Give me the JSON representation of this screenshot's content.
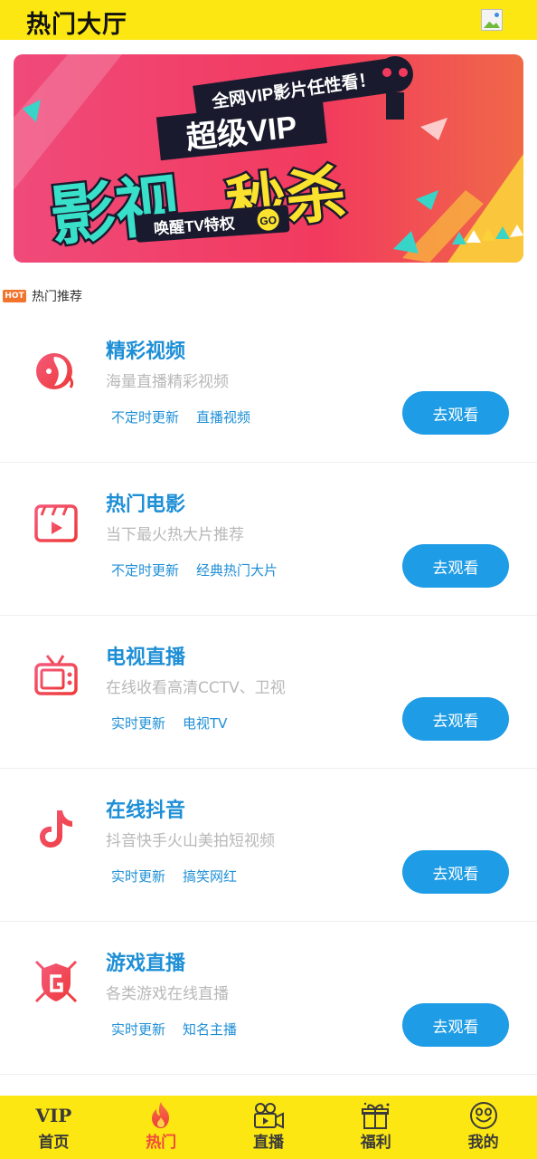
{
  "header": {
    "title": "热门大厅"
  },
  "banner": {
    "top_text": "全网VIP影片任性看！",
    "super_vip": "超级VIP",
    "main_text_1": "影视",
    "main_text_2": "秒杀",
    "sub_text": "唤醒TV特权",
    "go": "GO"
  },
  "section": {
    "badge": "HOT",
    "label": "热门推荐"
  },
  "cards": [
    {
      "title": "精彩视频",
      "desc": "海量直播精彩视频",
      "tags": [
        "不定时更新",
        "直播视频"
      ],
      "button": "去观看",
      "icon": "woman-face-icon"
    },
    {
      "title": "热门电影",
      "desc": "当下最火热大片推荐",
      "tags": [
        "不定时更新",
        "经典热门大片"
      ],
      "button": "去观看",
      "icon": "clapperboard-icon"
    },
    {
      "title": "电视直播",
      "desc": "在线收看高清CCTV、卫视",
      "tags": [
        "实时更新",
        "电视TV"
      ],
      "button": "去观看",
      "icon": "tv-icon"
    },
    {
      "title": "在线抖音",
      "desc": "抖音快手火山美拍短视频",
      "tags": [
        "实时更新",
        "搞笑网红"
      ],
      "button": "去观看",
      "icon": "tiktok-icon"
    },
    {
      "title": "游戏直播",
      "desc": "各类游戏在线直播",
      "tags": [
        "实时更新",
        "知名主播"
      ],
      "button": "去观看",
      "icon": "game-shield-icon"
    }
  ],
  "tabbar": {
    "active_color": "#f04a3d",
    "items": [
      {
        "label": "首页",
        "icon": "vip-icon",
        "icon_text": "VIP"
      },
      {
        "label": "热门",
        "icon": "flame-icon",
        "active": true
      },
      {
        "label": "直播",
        "icon": "video-camera-icon"
      },
      {
        "label": "福利",
        "icon": "gift-icon"
      },
      {
        "label": "我的",
        "icon": "smiley-icon"
      }
    ]
  }
}
